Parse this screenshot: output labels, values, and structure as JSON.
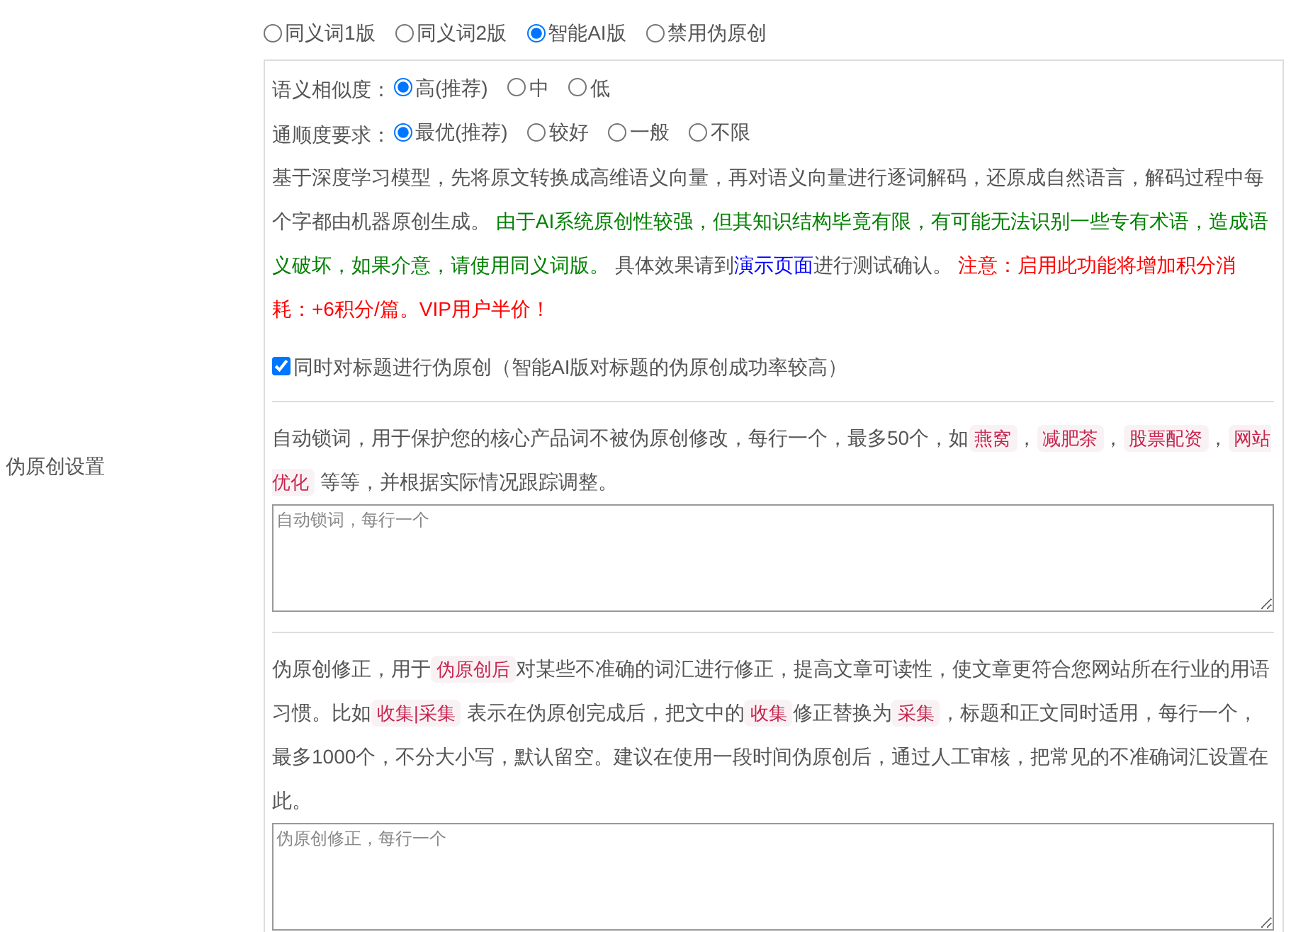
{
  "section_label": "伪原创设置",
  "versions": [
    {
      "label": "同义词1版",
      "selected": false
    },
    {
      "label": "同义词2版",
      "selected": false
    },
    {
      "label": "智能AI版",
      "selected": true
    },
    {
      "label": "禁用伪原创",
      "selected": false
    }
  ],
  "similarity": {
    "label": "语义相似度：",
    "options": [
      {
        "label": "高(推荐)",
        "selected": true
      },
      {
        "label": "中",
        "selected": false
      },
      {
        "label": "低",
        "selected": false
      }
    ]
  },
  "fluency": {
    "label": "通顺度要求：",
    "options": [
      {
        "label": "最优(推荐)",
        "selected": true
      },
      {
        "label": "较好",
        "selected": false
      },
      {
        "label": "一般",
        "selected": false
      },
      {
        "label": "不限",
        "selected": false
      }
    ]
  },
  "description": [
    {
      "kind": "plain",
      "text": "基于深度学习模型，先将原文转换成高维语义向量，再对语义向量进行逐词解码，还原成自然语言，解码过程中每个字都由机器原创生成。 "
    },
    {
      "kind": "notice",
      "text": "由于AI系统原创性较强，但其知识结构毕竟有限，有可能无法识别一些专有术语，造成语义破坏，如果介意，请使用同义词版。"
    },
    {
      "kind": "plain",
      "text": " 具体效果请到"
    },
    {
      "kind": "link",
      "text": "演示页面"
    },
    {
      "kind": "plain",
      "text": "进行测试确认。 "
    },
    {
      "kind": "warning",
      "text": "注意：启用此功能将增加积分消耗：+6积分/篇。VIP用户半价！"
    }
  ],
  "title_option": {
    "label": "同时对标题进行伪原创（智能AI版对标题的伪原创成功率较高）",
    "checked": true
  },
  "lock_words": {
    "description": [
      {
        "kind": "plain",
        "text": "自动锁词，用于保护您的核心产品词不被伪原创修改，每行一个，最多50个，如"
      },
      {
        "kind": "code",
        "text": "燕窝"
      },
      {
        "kind": "plain",
        "text": "，"
      },
      {
        "kind": "code",
        "text": "减肥茶"
      },
      {
        "kind": "plain",
        "text": "，"
      },
      {
        "kind": "code",
        "text": "股票配资"
      },
      {
        "kind": "plain",
        "text": "，"
      },
      {
        "kind": "code",
        "text": "网站优化"
      },
      {
        "kind": "plain",
        "text": " 等等，并根据实际情况跟踪调整。"
      }
    ],
    "placeholder": "自动锁词，每行一个"
  },
  "correction": {
    "description": [
      {
        "kind": "plain",
        "text": "伪原创修正，用于"
      },
      {
        "kind": "code",
        "text": "伪原创后"
      },
      {
        "kind": "plain",
        "text": "对某些不准确的词汇进行修正，提高文章可读性，使文章更符合您网站所在行业的用语习惯。比如"
      },
      {
        "kind": "code",
        "text": "收集|采集"
      },
      {
        "kind": "plain",
        "text": " 表示在伪原创完成后，把文中的"
      },
      {
        "kind": "code",
        "text": "收集"
      },
      {
        "kind": "plain",
        "text": "修正替换为"
      },
      {
        "kind": "code",
        "text": "采集"
      },
      {
        "kind": "plain",
        "text": "，标题和正文同时适用，每行一个，最多1000个，不分大小写，默认留空。建议在使用一段时间伪原创后，通过人工审核，把常见的不准确词汇设置在此。"
      }
    ],
    "placeholder": "伪原创修正，每行一个"
  }
}
